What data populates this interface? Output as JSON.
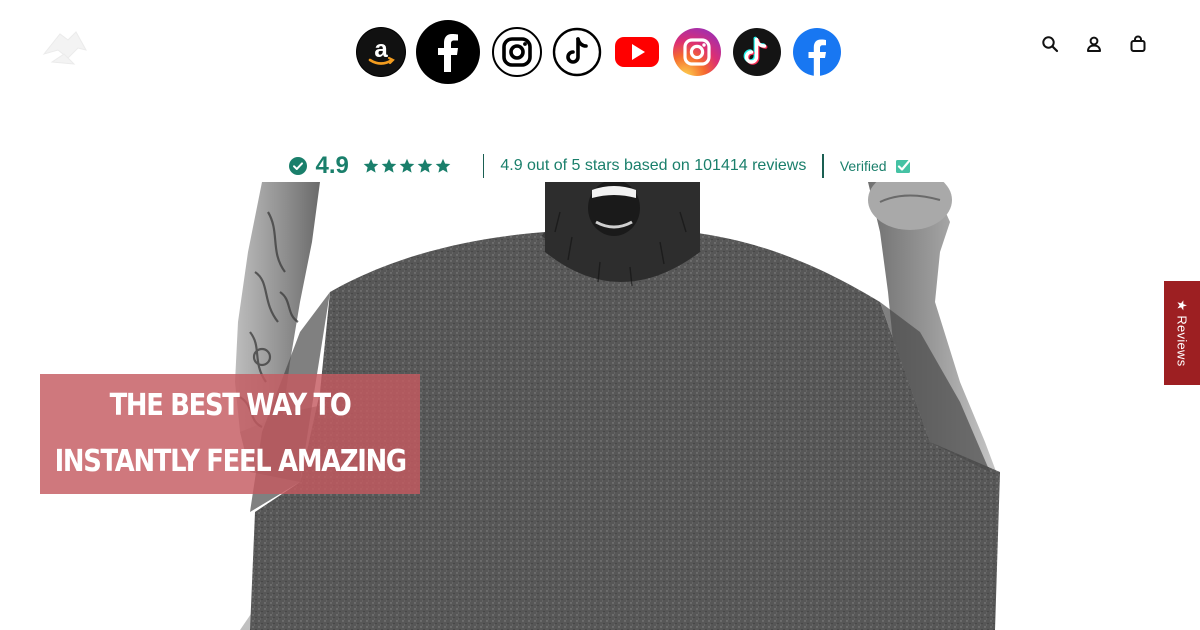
{
  "header": {
    "socials": [
      {
        "name": "amazon-icon"
      },
      {
        "name": "facebook-icon"
      },
      {
        "name": "instagram-icon"
      },
      {
        "name": "tiktok-icon"
      },
      {
        "name": "youtube-icon"
      },
      {
        "name": "instagram-color-icon"
      },
      {
        "name": "tiktok-color-icon"
      },
      {
        "name": "facebook-color-icon"
      }
    ],
    "actions": [
      "search-icon",
      "account-icon",
      "cart-icon"
    ]
  },
  "rating": {
    "score": "4.9",
    "summary": "4.9 out of 5 stars based on 101414 reviews",
    "verified": "Verified",
    "star_count": 5,
    "color": "#1a7f6b"
  },
  "hero": {
    "headline_line1": "THE BEST WAY TO",
    "headline_line2": "INSTANTLY FEEL AMAZING",
    "overlay_color": "#c45a60"
  },
  "reviews_tab": {
    "label": "★ Reviews",
    "color": "#9d1f22"
  }
}
